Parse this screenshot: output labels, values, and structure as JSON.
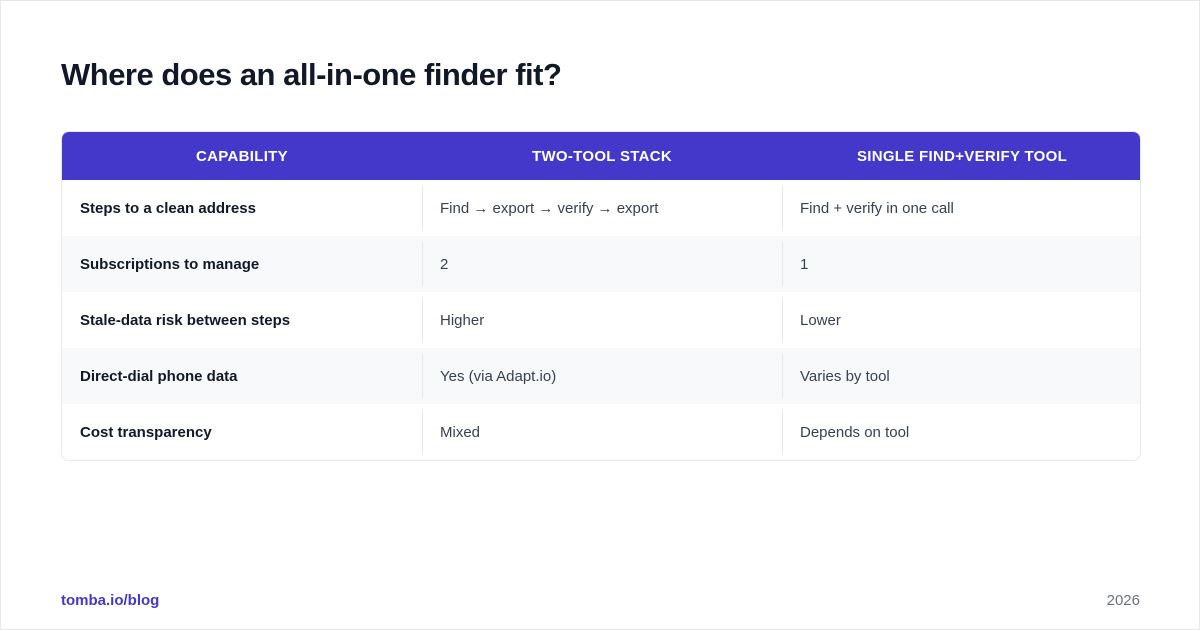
{
  "title": "Where does an all-in-one finder fit?",
  "table": {
    "headers": [
      "CAPABILITY",
      "TWO-TOOL STACK",
      "SINGLE FIND+VERIFY TOOL"
    ],
    "rows": [
      [
        "Steps to a clean address",
        "Find → export → verify → export",
        "Find + verify in one call"
      ],
      [
        "Subscriptions to manage",
        "2",
        "1"
      ],
      [
        "Stale-data risk between steps",
        "Higher",
        "Lower"
      ],
      [
        "Direct-dial phone data",
        "Yes (via Adapt.io)",
        "Varies by tool"
      ],
      [
        "Cost transparency",
        "Mixed",
        "Depends on tool"
      ]
    ]
  },
  "footer": {
    "link": "tomba.io/blog",
    "year": "2026"
  },
  "colors": {
    "header_bg": "#4338ca",
    "accent": "#4338ca",
    "title_text": "#111827",
    "alt_row_bg": "#f8f9fb"
  }
}
